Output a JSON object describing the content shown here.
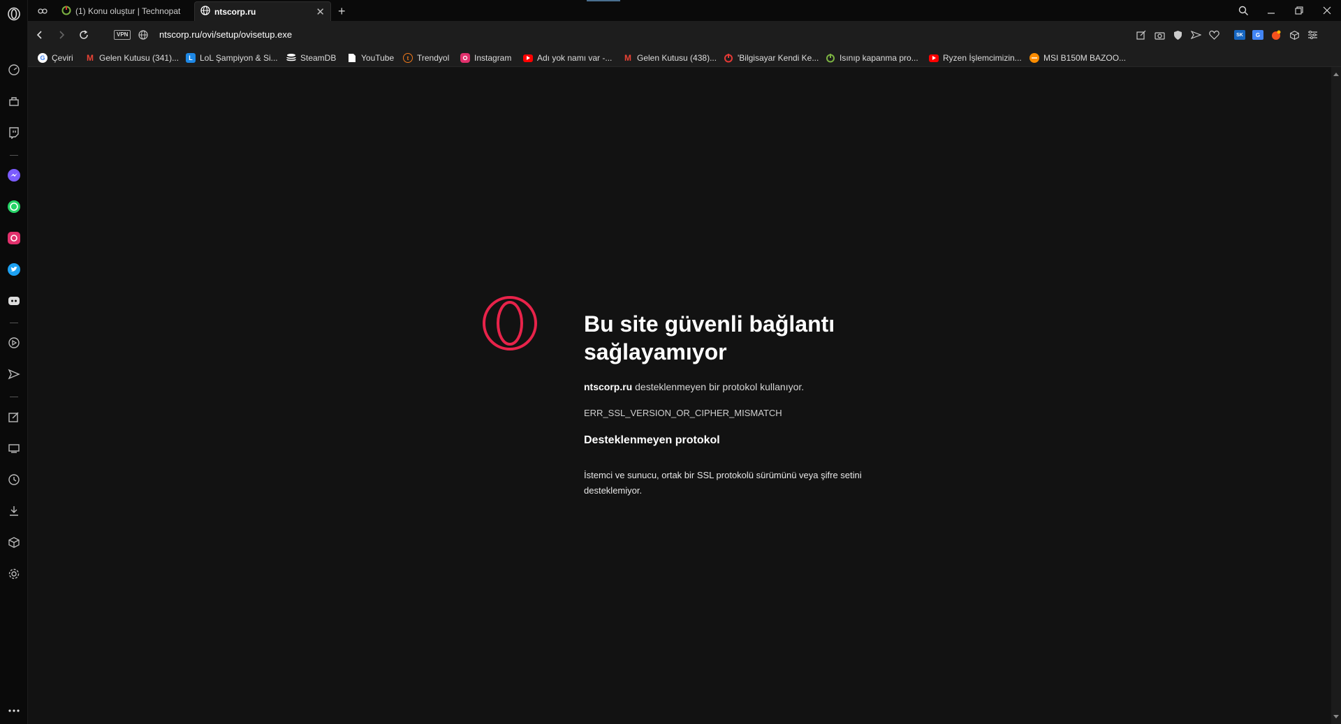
{
  "browser": {
    "tabs": [
      {
        "title": "(1) Konu oluştur | Technopat",
        "active": false
      },
      {
        "title": "ntscorp.ru",
        "active": true
      }
    ],
    "new_tab_label": "+",
    "vpn_label": "VPN",
    "url": "ntscorp.ru/ovi/setup/ovisetup.exe"
  },
  "bookmarks": [
    {
      "label": "Çeviri",
      "icon": "google-icon",
      "color": "#4285F4"
    },
    {
      "label": "Gelen Kutusu (341)...",
      "icon": "gmail-icon",
      "color": "#EA4335"
    },
    {
      "label": "LoL Şampiyon & Si...",
      "icon": "lol-icon",
      "color": "#1E88E5"
    },
    {
      "label": "SteamDB",
      "icon": "steamdb-icon",
      "color": "#ffffff"
    },
    {
      "label": "YouTube",
      "icon": "page-icon",
      "color": "#ffffff"
    },
    {
      "label": "Trendyol",
      "icon": "trendyol-icon",
      "color": "#F27A1A"
    },
    {
      "label": "Instagram",
      "icon": "instagram-icon",
      "color": "#E1306C"
    },
    {
      "label": "Adı yok namı var -...",
      "icon": "youtube-icon",
      "color": "#FF0000"
    },
    {
      "label": "Gelen Kutusu (438)...",
      "icon": "gmail-icon",
      "color": "#EA4335"
    },
    {
      "label": "'Bilgisayar Kendi Ke...",
      "icon": "power-red-icon",
      "color": "#E53935"
    },
    {
      "label": "Isınıp kapanma pro...",
      "icon": "power-green-icon",
      "color": "#7CB342"
    },
    {
      "label": "Ryzen İşlemcimizin...",
      "icon": "youtube-icon",
      "color": "#FF0000"
    },
    {
      "label": "MSI B150M BAZOO...",
      "icon": "orange-circle-icon",
      "color": "#FB8C00"
    }
  ],
  "error": {
    "title": "Bu site güvenli bağlantı sağlayamıyor",
    "site": "ntscorp.ru",
    "desc_rest": " desteklenmeyen bir protokol kullanıyor.",
    "code": "ERR_SSL_VERSION_OR_CIPHER_MISMATCH",
    "sub_title": "Desteklenmeyen protokol",
    "sub_text": "İstemci ve sunucu, ortak bir SSL protokolü sürümünü veya şifre setini desteklemiyor."
  },
  "colors": {
    "opera_red": "#E8234A",
    "background": "#121212"
  }
}
